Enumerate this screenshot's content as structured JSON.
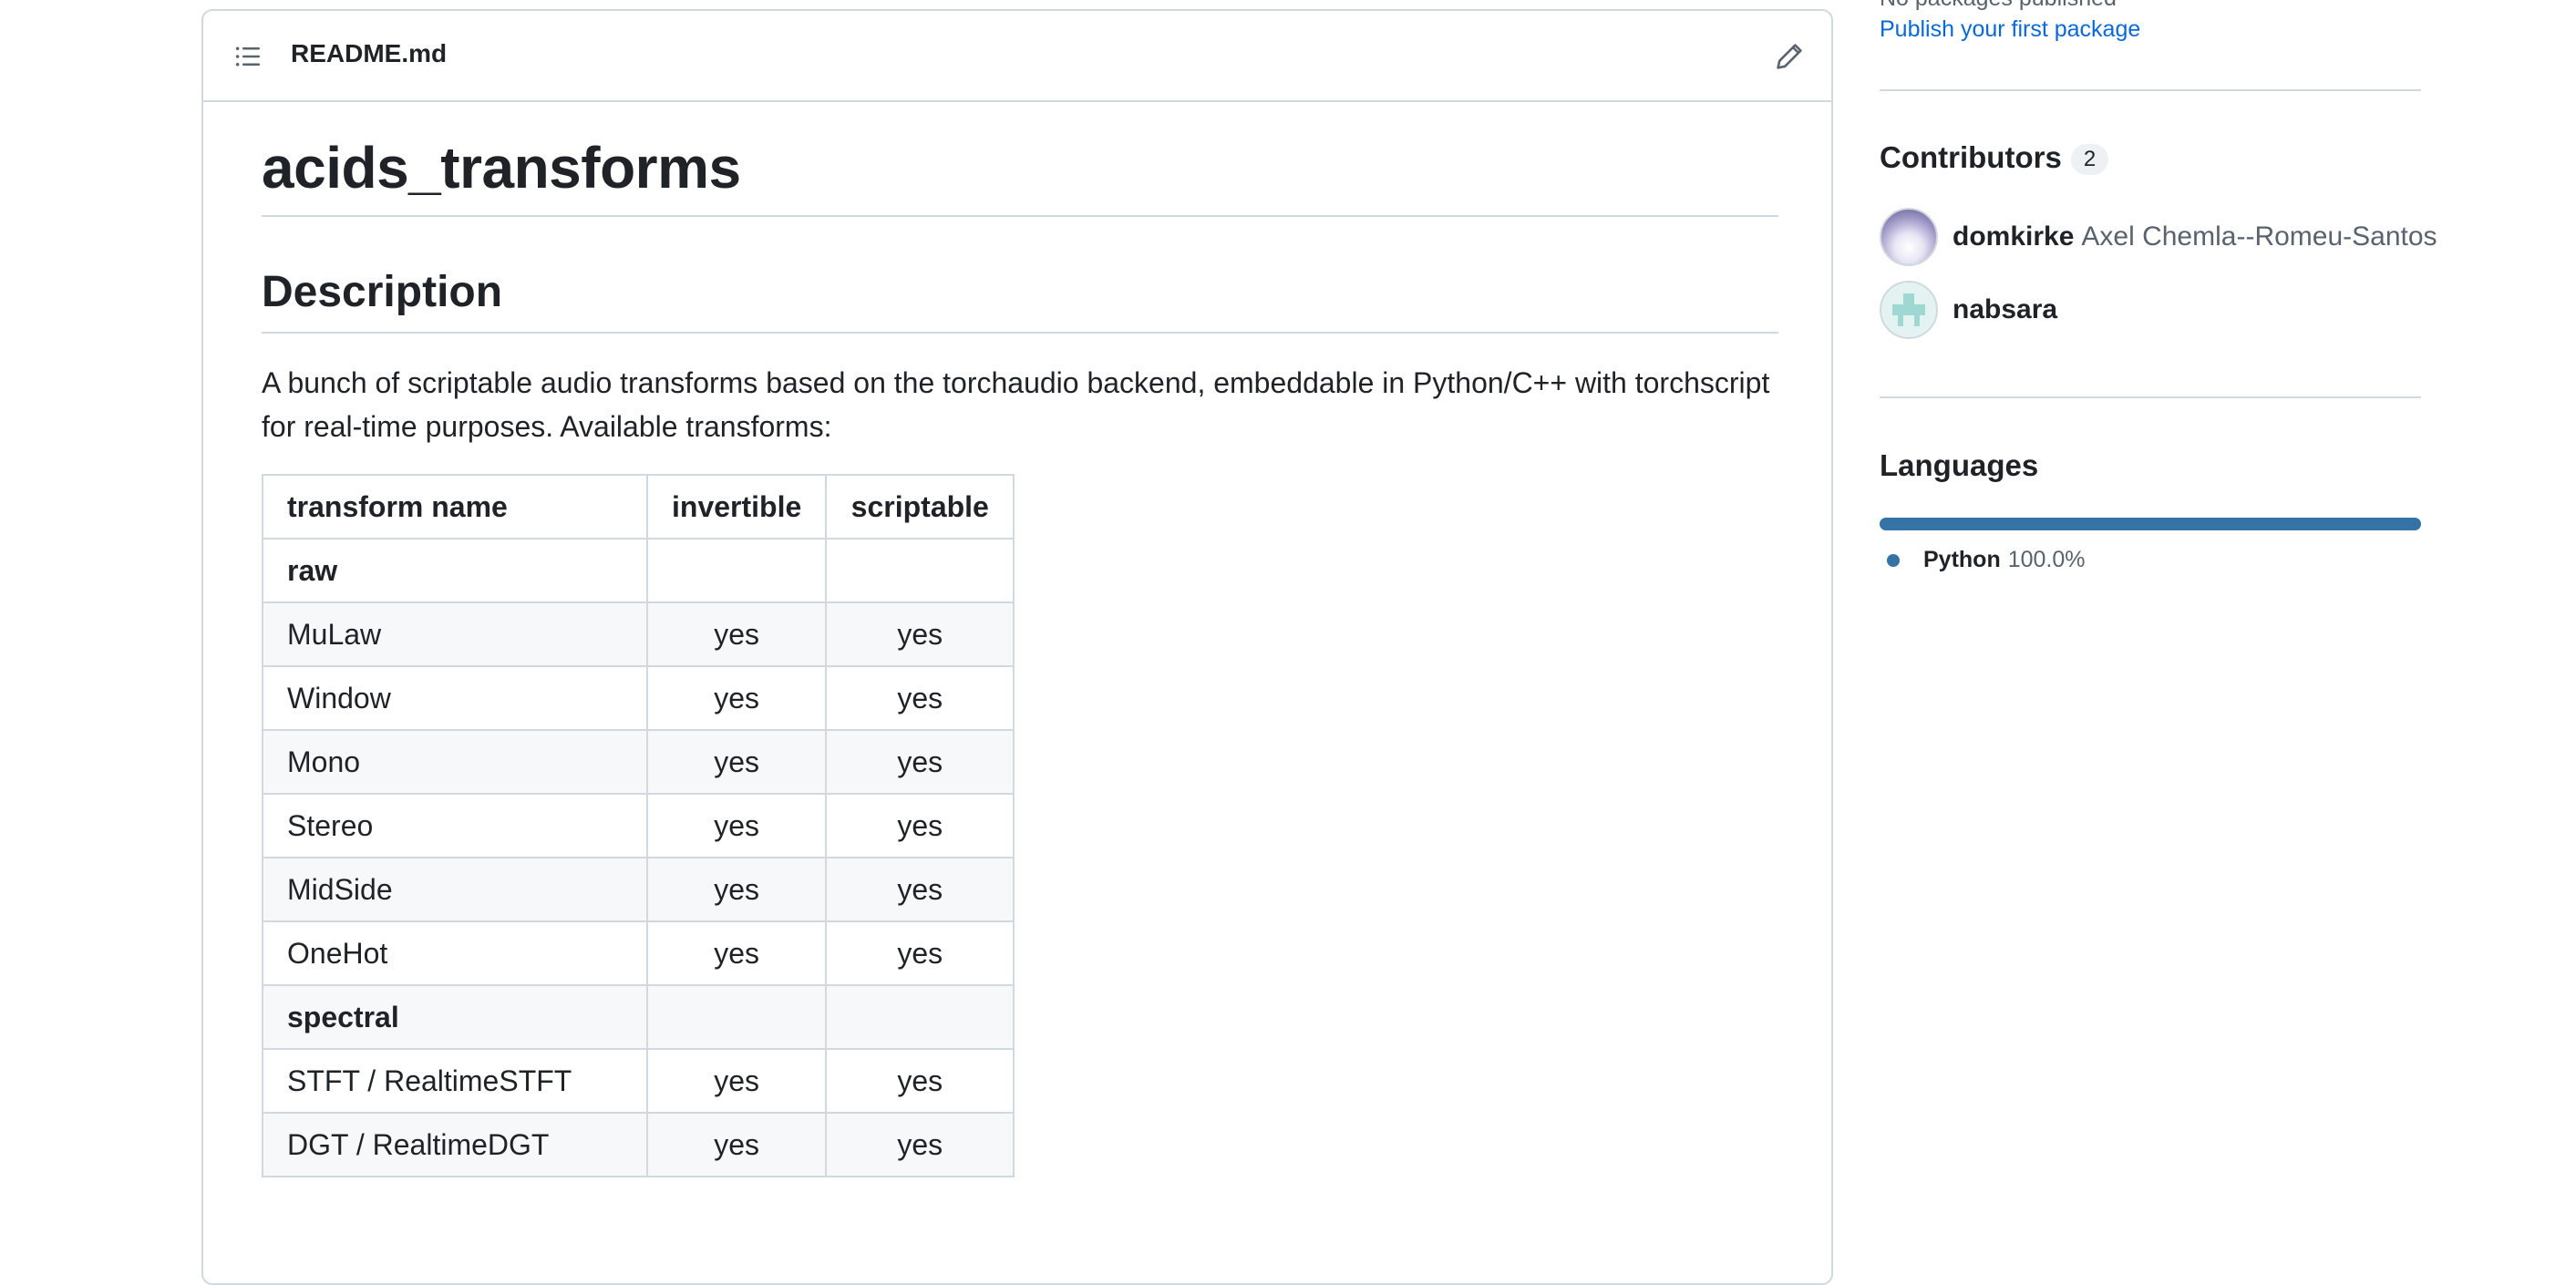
{
  "readme": {
    "filename": "README.md",
    "title": "acids_transforms",
    "section_heading": "Description",
    "description": "A bunch of scriptable audio transforms based on the torchaudio backend, embeddable in Python/C++ with torchscript for real-time purposes. Available transforms:",
    "table": {
      "headers": [
        "transform name",
        "invertible",
        "scriptable"
      ],
      "rows": [
        {
          "name": "raw",
          "invertible": "",
          "scriptable": "",
          "group": true
        },
        {
          "name": "MuLaw",
          "invertible": "yes",
          "scriptable": "yes"
        },
        {
          "name": "Window",
          "invertible": "yes",
          "scriptable": "yes"
        },
        {
          "name": "Mono",
          "invertible": "yes",
          "scriptable": "yes"
        },
        {
          "name": "Stereo",
          "invertible": "yes",
          "scriptable": "yes"
        },
        {
          "name": "MidSide",
          "invertible": "yes",
          "scriptable": "yes"
        },
        {
          "name": "OneHot",
          "invertible": "yes",
          "scriptable": "yes"
        },
        {
          "name": "spectral",
          "invertible": "",
          "scriptable": "",
          "group": true
        },
        {
          "name": "STFT / RealtimeSTFT",
          "invertible": "yes",
          "scriptable": "yes"
        },
        {
          "name": "DGT / RealtimeDGT",
          "invertible": "yes",
          "scriptable": "yes"
        }
      ]
    }
  },
  "sidebar": {
    "packages": {
      "none_text": "No packages published",
      "publish_link": "Publish your first package"
    },
    "contributors": {
      "title": "Contributors",
      "count": "2",
      "items": [
        {
          "login": "domkirke",
          "name": "Axel Chemla--Romeu-Santos"
        },
        {
          "login": "nabsara",
          "name": ""
        }
      ]
    },
    "languages": {
      "title": "Languages",
      "items": [
        {
          "name": "Python",
          "percent": "100.0%",
          "share": 1.0,
          "color": "#3572A5"
        }
      ]
    }
  },
  "icons": {
    "toc": "list-unordered-icon",
    "edit": "pencil-icon"
  }
}
